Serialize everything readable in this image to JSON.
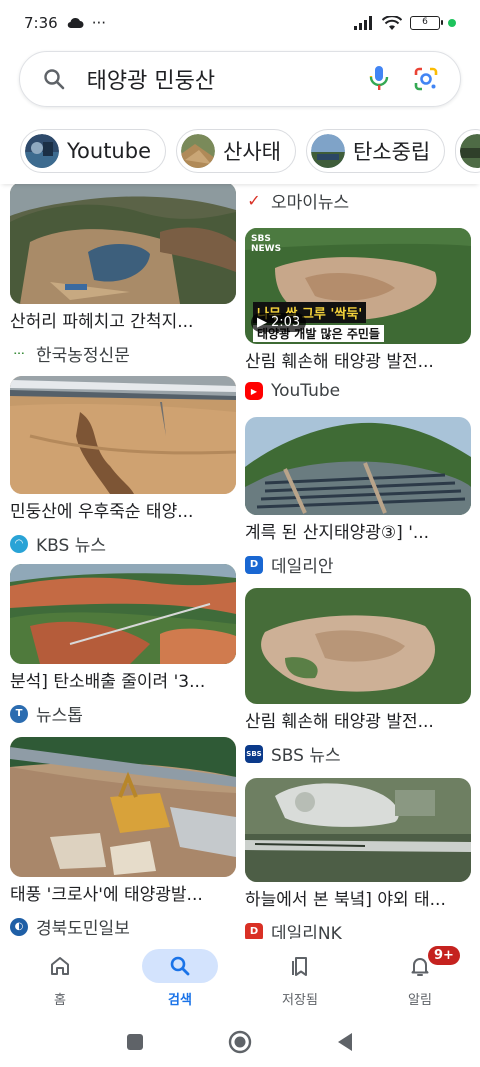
{
  "status": {
    "time": "7:36",
    "more": "···",
    "battery": "6"
  },
  "search": {
    "query": "태양광 민둥산"
  },
  "chips": [
    {
      "label": "Youtube"
    },
    {
      "label": "산사태"
    },
    {
      "label": "탄소중립"
    }
  ],
  "results": [
    {
      "title": "산허리 파헤치고 간척지...",
      "source": "한국농정신문"
    },
    {
      "title": "민둥산에 우후죽순 태양...",
      "source": "KBS 뉴스"
    },
    {
      "title": "분석] 탄소배출 줄이려 '3...",
      "source": "뉴스톱"
    },
    {
      "title": "태풍 '크로사'에 태양광발...",
      "source": "경북도민일보"
    },
    {
      "title": "",
      "source": "오마이뉴스"
    },
    {
      "title": "산림 훼손해 태양광 발전...",
      "source": "YouTube",
      "duration": "2:03",
      "overlay_lines": [
        "나무 싹 그루 '싹둑'",
        "태양광 개발 많은 주민들"
      ],
      "overlay_logo": "SBS NEWS"
    },
    {
      "title": "계륵 된 산지태양광③] '...",
      "source": "데일리안"
    },
    {
      "title": "산림 훼손해 태양광 발전...",
      "source": "SBS 뉴스"
    },
    {
      "title": "하늘에서 본 북녘] 야외 태...",
      "source": "데일리NK"
    }
  ],
  "nav": {
    "home": "홈",
    "search": "검색",
    "saved": "저장됨",
    "notifications": "알림",
    "badge": "9+"
  },
  "colors": {
    "accent": "#1a73e8",
    "badge": "#c5221f"
  }
}
